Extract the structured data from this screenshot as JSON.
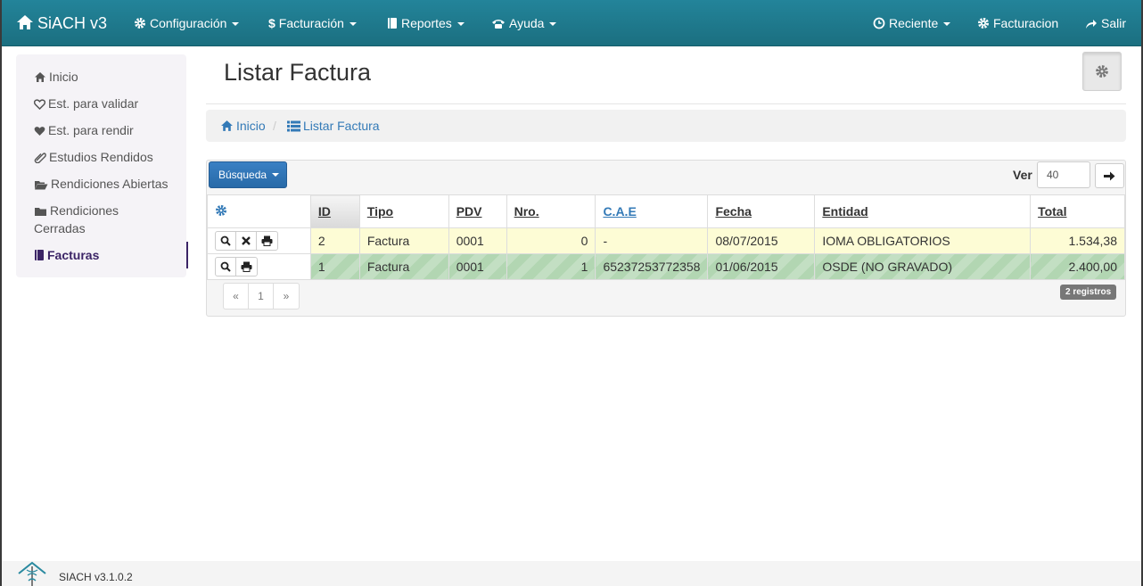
{
  "navbar": {
    "brand": "SiACH v3",
    "menus": [
      {
        "label": "Configuración",
        "icon": "gear-icon"
      },
      {
        "label": "Facturación",
        "icon": "dollar-icon"
      },
      {
        "label": "Reportes",
        "icon": "book-icon"
      },
      {
        "label": "Ayuda",
        "icon": "phone-icon"
      }
    ],
    "right": [
      {
        "label": "Reciente",
        "icon": "clock-icon"
      },
      {
        "label": "Facturacion",
        "icon": "gear-icon"
      },
      {
        "label": "Salir",
        "icon": "share-icon"
      }
    ]
  },
  "sidebar": {
    "items": [
      {
        "label": "Inicio",
        "icon": "home-icon"
      },
      {
        "label": "Est. para validar",
        "icon": "heart-outline-icon"
      },
      {
        "label": "Est. para rendir",
        "icon": "heart-icon"
      },
      {
        "label": "Estudios Rendidos",
        "icon": "paperclip-icon"
      },
      {
        "label": "Rendiciones Abiertas",
        "icon": "folder-open-icon"
      },
      {
        "label": "Rendiciones",
        "label2": "Cerradas",
        "icon": "folder-icon"
      },
      {
        "label": "Facturas",
        "icon": "book-icon"
      }
    ]
  },
  "page": {
    "title": "Listar Factura"
  },
  "breadcrumb": [
    {
      "label": "Inicio",
      "icon": "home-icon"
    },
    {
      "label": "Listar Factura",
      "icon": "list-icon"
    }
  ],
  "toolbar": {
    "search_label": "Búsqueda",
    "ver_label": "Ver",
    "ver_value": "40"
  },
  "table": {
    "columns": [
      "ID",
      "Tipo",
      "PDV",
      "Nro.",
      "C.A.E",
      "Fecha",
      "Entidad",
      "Total"
    ],
    "rows": [
      {
        "id": "2",
        "tipo": "Factura",
        "pdv": "0001",
        "nro": "0",
        "cae": "-",
        "fecha": "08/07/2015",
        "entidad": "IOMA OBLIGATORIOS",
        "total": "1.534,38"
      },
      {
        "id": "1",
        "tipo": "Factura",
        "pdv": "0001",
        "nro": "1",
        "cae": "65237253772358",
        "fecha": "01/06/2015",
        "entidad": "OSDE (NO GRAVADO)",
        "total": "2.400,00"
      }
    ]
  },
  "pager": {
    "prev": "«",
    "page": "1",
    "next": "»"
  },
  "count_badge": "2 registros",
  "footer": {
    "version": "SIACH v3.1.0.2"
  },
  "colors": {
    "navbar": "#1f7a8c",
    "primary": "#2c6fb4",
    "link": "#337ab7",
    "row_yellow": "#fdfcd5",
    "row_green": "#c3dfc3"
  }
}
